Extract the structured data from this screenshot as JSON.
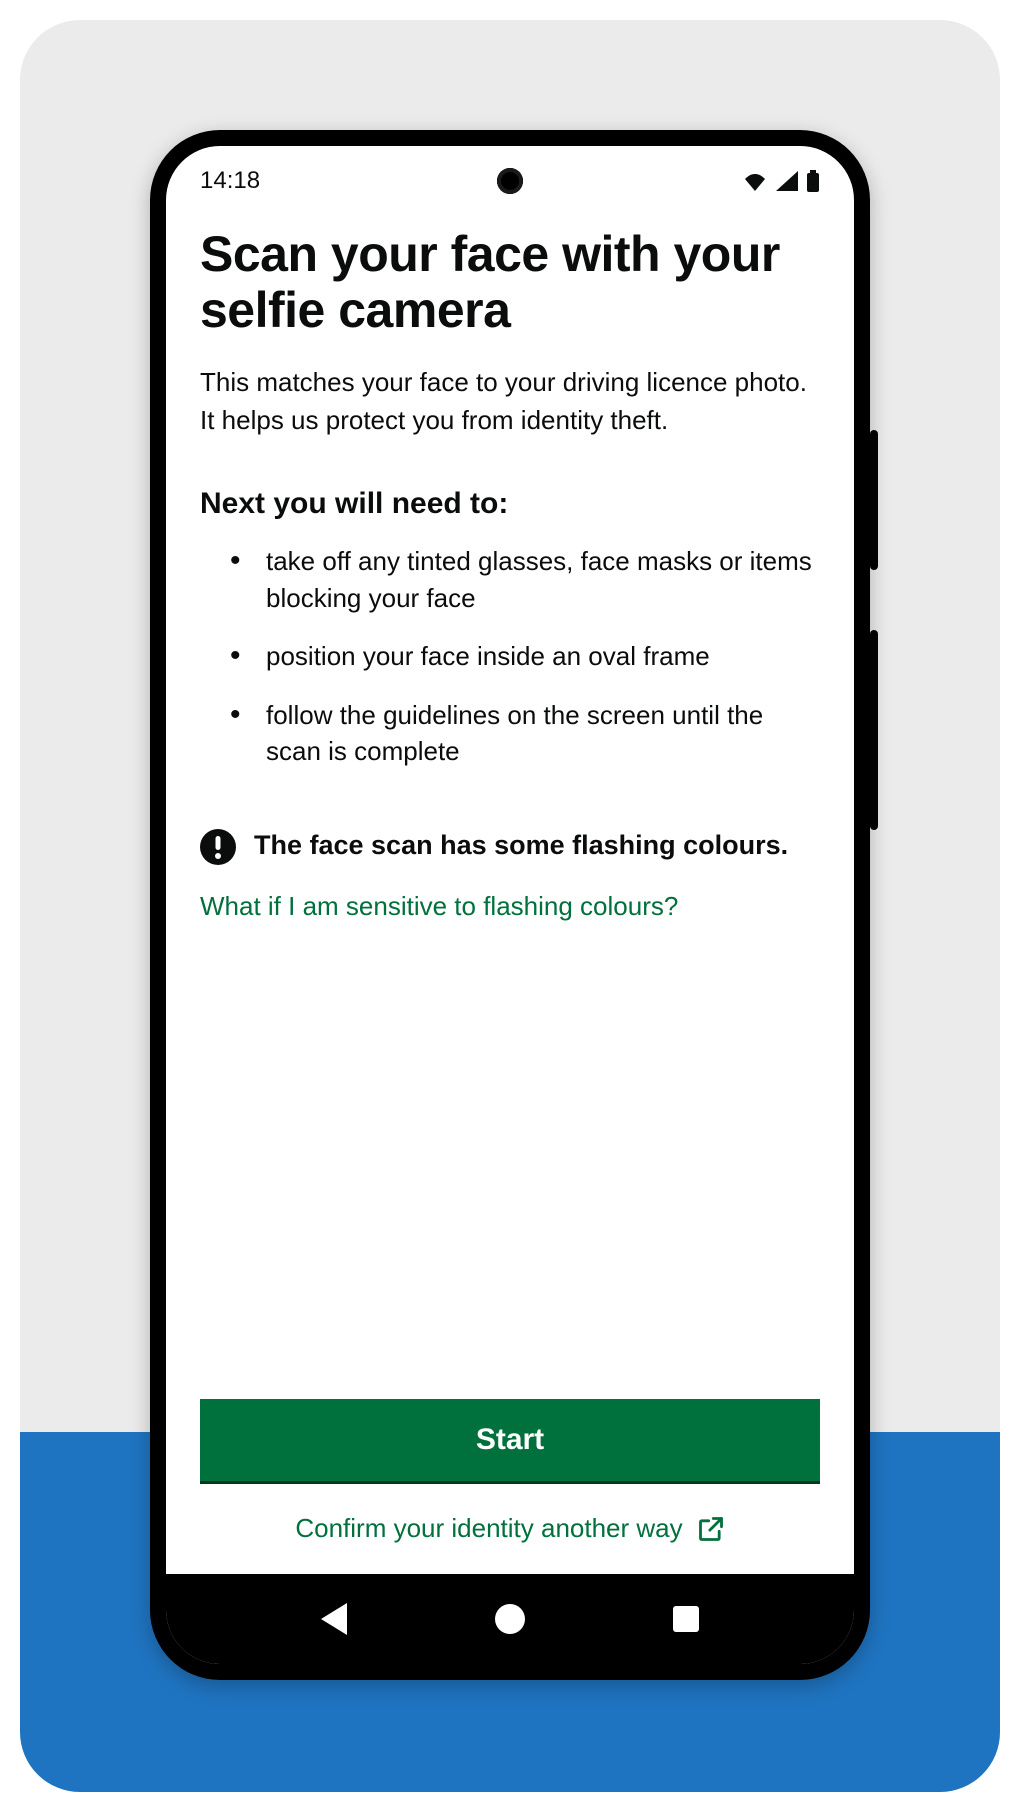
{
  "status": {
    "time": "14:18"
  },
  "page": {
    "title": "Scan your face with your selfie camera",
    "lead": "This matches your face to your driving licence photo. It helps us protect you from identity theft.",
    "subhead": "Next you will need to:",
    "steps": [
      "take off any tinted glasses, face masks or items blocking your face",
      "position your face inside an oval  frame",
      "follow the guidelines on the screen until the scan is complete"
    ],
    "warning": "The face scan has some flashing colours.",
    "sensitive_link": "What if I am sensitive to flashing colours?",
    "primary_button": "Start",
    "alt_link": "Confirm your identity another way"
  },
  "colors": {
    "accent": "#00703c",
    "band": "#1f74c1"
  }
}
